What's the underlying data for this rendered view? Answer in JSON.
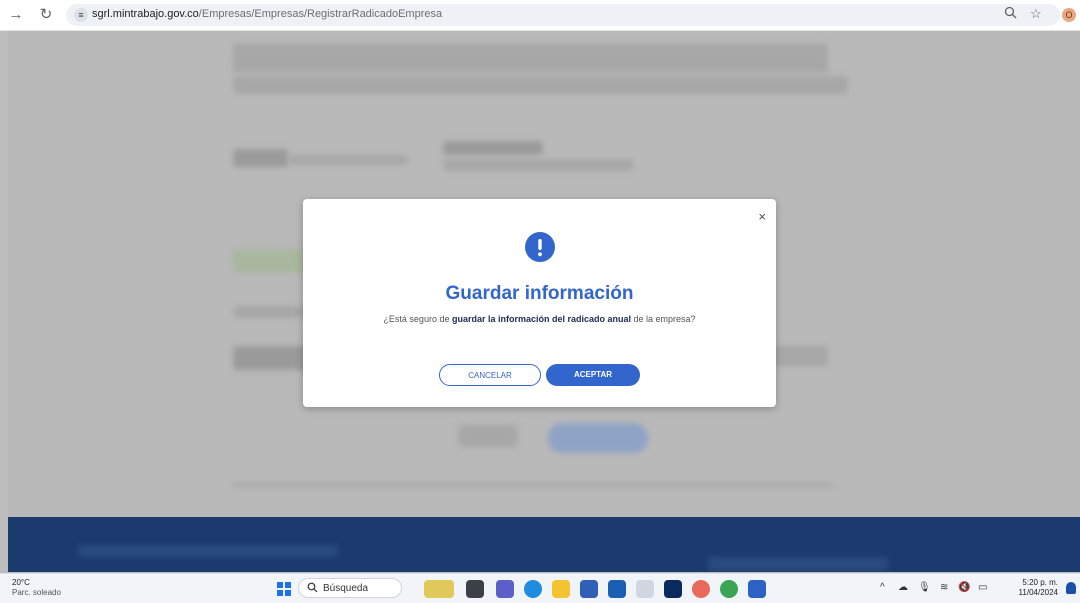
{
  "browser": {
    "url_host": "sgrl.mintrabajo.gov.co",
    "url_path": "/Empresas/Empresas/RegistrarRadicadoEmpresa",
    "profile_initial": "O",
    "icons": {
      "forward": "forward-arrow-icon",
      "reload": "reload-icon",
      "site_info": "tune-icon",
      "zoom": "zoom-icon",
      "bookmark": "star-icon"
    }
  },
  "modal": {
    "icon": "exclamation-icon",
    "title": "Guardar información",
    "message_prefix": "¿Está seguro de ",
    "message_bold": "guardar la información del radicado anual",
    "message_suffix": " de la empresa?",
    "cancel_label": "CANCELAR",
    "accept_label": "ACEPTAR",
    "close_label": "×"
  },
  "taskbar": {
    "weather_temp": "20°C",
    "weather_desc": "Parc. soleado",
    "search_label": "Búsqueda",
    "time": "5:20 p. m.",
    "date": "11/04/2024"
  },
  "colors": {
    "accent": "#3366cc",
    "overlay": "#bdbdbd",
    "footer": "#1b3a6d"
  }
}
